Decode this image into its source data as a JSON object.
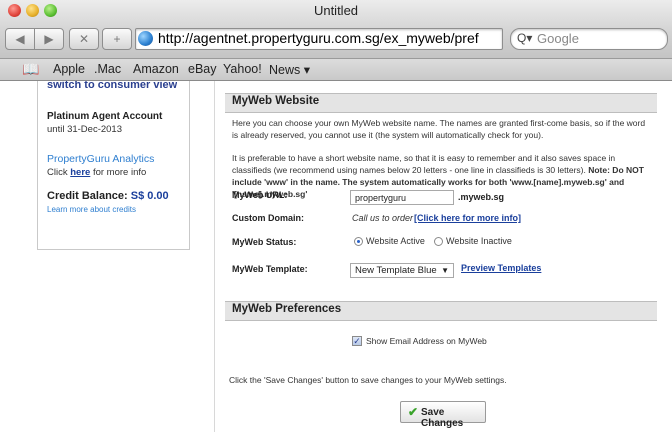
{
  "window": {
    "title": "Untitled"
  },
  "toolbar": {
    "back_icon": "◀",
    "forward_icon": "▶",
    "stop_icon": "✕",
    "add_icon": "+",
    "url": "http://agentnet.propertyguru.com.sg/ex_myweb/pref",
    "search_placeholder": "Google",
    "search_icon": "Q▾"
  },
  "bookmarks": {
    "icon": "📖",
    "items": [
      "Apple",
      ".Mac",
      "Amazon",
      "eBay",
      "Yahoo!",
      "News ▾"
    ]
  },
  "sidebar": {
    "top_link_cut": "switch to consumer view",
    "account_title": "Platinum Agent Account",
    "account_until": "until 31-Dec-2013",
    "analytics_title": "PropertyGuru Analytics",
    "click_prefix": "Click ",
    "click_link": "here",
    "click_suffix": " for more info",
    "credit_label": "Credit Balance: ",
    "credit_amount": "S$ 0.00",
    "credit_link": "Learn more about credits"
  },
  "myweb": {
    "section_title": "MyWeb Website",
    "intro": "Here you can choose your own MyWeb website name. The names are granted first-come basis, so if the word is already reserved, you cannot use it (the system will automatically check for you).",
    "tip_plain": "It is preferable to have a short website name, so that it is easy to remember and it also saves space in classifieds (we recommend using names below 20 letters - one line in classifieds is 30 letters). ",
    "tip_bold": "Note: Do NOT include 'www' in the name. The system automatically works for both 'www.[name].myweb.sg' and '[name].myweb.sg'",
    "url_label": "MyWeb URL:",
    "url_value": "propertyguru",
    "url_suffix": ".myweb.sg",
    "domain_label": "Custom Domain:",
    "domain_note": "Call us to order",
    "domain_link": "[Click here for more info]",
    "status_label": "MyWeb Status:",
    "status_active": "Website Active",
    "status_inactive": "Website Inactive",
    "template_label": "MyWeb Template:",
    "template_value": "New Template Blue",
    "template_arrow": "▼",
    "preview_link": "Preview Templates"
  },
  "preferences": {
    "section_title": "MyWeb Preferences",
    "show_email_label": "Show Email Address on MyWeb",
    "show_email_checked": true,
    "check_mark": "✓"
  },
  "footer": {
    "note": "Click the 'Save Changes' button to save changes to your MyWeb settings.",
    "save_icon": "✔",
    "save_label": "Save Changes"
  }
}
